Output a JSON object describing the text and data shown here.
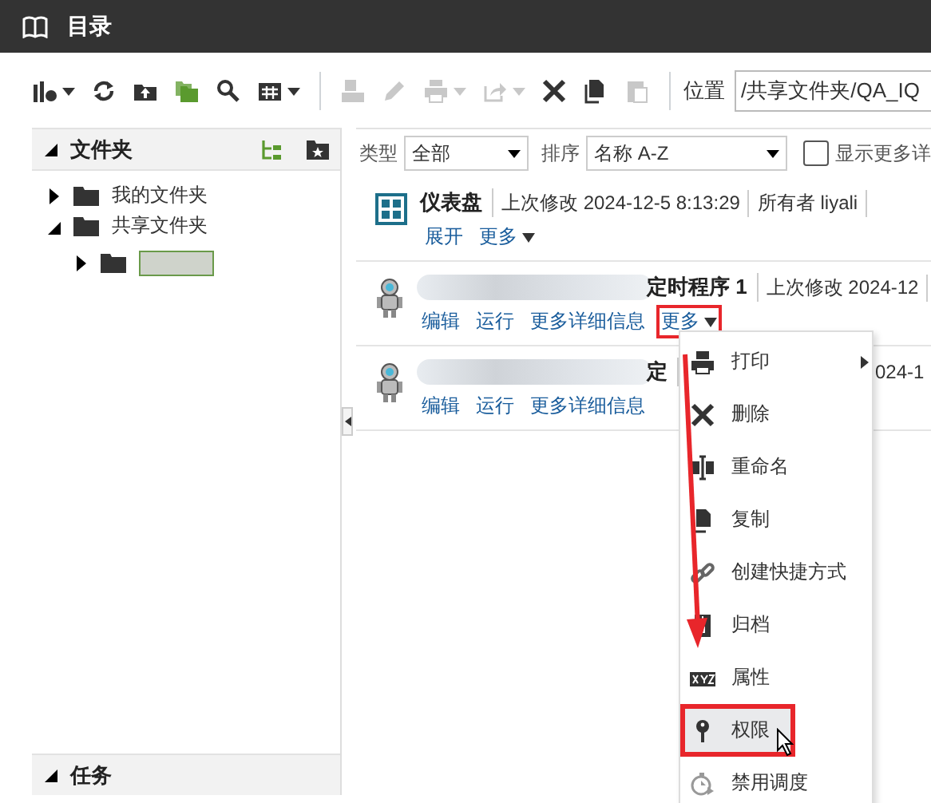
{
  "header": {
    "title": "目录"
  },
  "toolbar": [
    {
      "kind": "chart",
      "dropdown": true,
      "disabled": false
    },
    {
      "kind": "refresh",
      "dropdown": false,
      "disabled": false
    },
    {
      "kind": "upload",
      "dropdown": false,
      "disabled": false
    },
    {
      "kind": "folders",
      "dropdown": false,
      "disabled": false
    },
    {
      "kind": "search",
      "dropdown": false,
      "disabled": false
    },
    {
      "kind": "grid",
      "dropdown": true,
      "disabled": false
    },
    {
      "kind": "separator"
    },
    {
      "kind": "stamp",
      "dropdown": false,
      "disabled": true
    },
    {
      "kind": "pencil",
      "dropdown": false,
      "disabled": true
    },
    {
      "kind": "printer",
      "dropdown": true,
      "disabled": true
    },
    {
      "kind": "share",
      "dropdown": true,
      "disabled": true
    },
    {
      "kind": "close",
      "dropdown": false,
      "disabled": false
    },
    {
      "kind": "copy",
      "dropdown": false,
      "disabled": false
    },
    {
      "kind": "paste",
      "dropdown": false,
      "disabled": true
    },
    {
      "kind": "separator"
    }
  ],
  "location": {
    "label": "位置",
    "value": "/共享文件夹/QA_IQ"
  },
  "sidebar": {
    "title": "文件夹",
    "expanded": true,
    "tree": [
      {
        "label": "我的文件夹",
        "expanded": false
      },
      {
        "label": "共享文件夹",
        "expanded": true,
        "children": [
          {
            "redacted": true,
            "expanded": false
          }
        ]
      }
    ],
    "bottom": {
      "title": "任务",
      "expanded": true
    }
  },
  "filters": {
    "type_label": "类型",
    "type_value": "全部",
    "sort_label": "排序",
    "sort_value": "名称 A-Z",
    "more_details": {
      "label": "显示更多详",
      "checked": false
    }
  },
  "items": [
    {
      "kind": "dashboard",
      "name": "仪表盘",
      "meta": [
        "上次修改 2024-12-5 8:13:29",
        "所有者 liyali"
      ],
      "covered": false,
      "actions": [
        {
          "label": "展开",
          "dropdown": false,
          "boxed": false
        },
        {
          "label": "更多",
          "dropdown": true,
          "boxed": false
        }
      ]
    },
    {
      "kind": "agent",
      "redacted": true,
      "name": "定时程序 1",
      "meta": [
        "上次修改 2024-12"
      ],
      "covered": false,
      "actions": [
        {
          "label": "编辑",
          "dropdown": false,
          "boxed": false
        },
        {
          "label": "运行",
          "dropdown": false,
          "boxed": false
        },
        {
          "label": "更多详细信息",
          "dropdown": false,
          "boxed": false
        },
        {
          "label": "更多",
          "dropdown": true,
          "boxed": true
        }
      ]
    },
    {
      "kind": "agent",
      "redacted": true,
      "name": "定",
      "meta": [
        "024-1"
      ],
      "covered": true,
      "actions": [
        {
          "label": "编辑",
          "dropdown": false,
          "boxed": false
        },
        {
          "label": "运行",
          "dropdown": false,
          "boxed": false
        },
        {
          "label": "更多详细信息",
          "dropdown": false,
          "boxed": false
        }
      ]
    }
  ],
  "menu": {
    "arrow": true,
    "items": [
      {
        "kind": "printer",
        "label": "打印",
        "submenu": true,
        "selected": false,
        "boxed": false,
        "disabled": false
      },
      {
        "kind": "delete",
        "label": "删除",
        "submenu": false,
        "selected": false,
        "boxed": false,
        "disabled": false
      },
      {
        "kind": "rename",
        "label": "重命名",
        "submenu": false,
        "selected": false,
        "boxed": false,
        "disabled": false
      },
      {
        "kind": "copy",
        "label": "复制",
        "submenu": false,
        "selected": false,
        "boxed": false,
        "disabled": false
      },
      {
        "kind": "link",
        "label": "创建快捷方式",
        "submenu": false,
        "selected": false,
        "boxed": false,
        "disabled": false
      },
      {
        "kind": "archive",
        "label": "归档",
        "submenu": false,
        "selected": false,
        "boxed": false,
        "disabled": false
      },
      {
        "kind": "properties",
        "label": "属性",
        "submenu": false,
        "selected": false,
        "boxed": false,
        "disabled": false
      },
      {
        "kind": "key",
        "label": "权限",
        "submenu": false,
        "selected": true,
        "boxed": true,
        "disabled": false
      },
      {
        "kind": "schedule",
        "label": "禁用调度",
        "submenu": false,
        "selected": false,
        "boxed": false,
        "disabled": false
      }
    ]
  }
}
